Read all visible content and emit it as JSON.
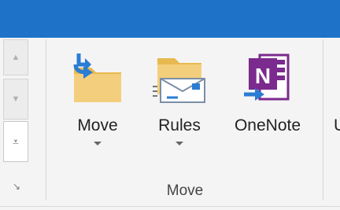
{
  "ribbon": {
    "gallery": {
      "up_label": "▲",
      "down_label": "▼",
      "more_label": "⩡"
    },
    "launcher_label": "↘",
    "group": {
      "label": "Move",
      "buttons": [
        {
          "label": "Move",
          "icon": "move-to-folder-icon",
          "has_dropdown": true
        },
        {
          "label": "Rules",
          "icon": "rules-icon",
          "has_dropdown": true
        },
        {
          "label": "OneNote",
          "icon": "onenote-icon",
          "has_dropdown": false
        }
      ]
    },
    "next_group_partial_label": "U"
  },
  "colors": {
    "titlebar": "#1e73c8",
    "folder": "#f3cf7d",
    "onenote": "#7b2a8e",
    "arrow": "#2b7cd3"
  }
}
